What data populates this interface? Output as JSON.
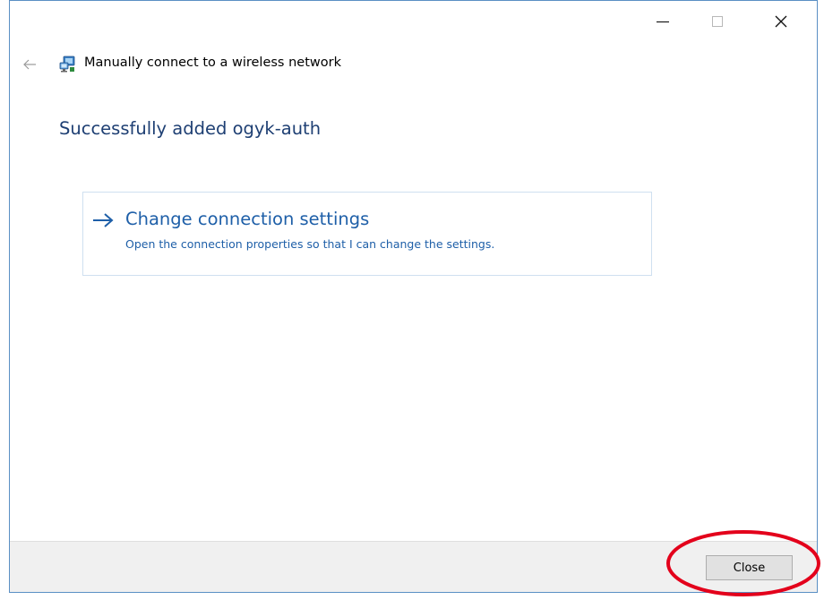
{
  "window": {
    "controls": {
      "minimize": "minimize-icon",
      "maximize": "maximize-icon",
      "close": "close-icon"
    }
  },
  "header": {
    "back_icon": "back-arrow-icon",
    "app_icon": "wireless-network-icon",
    "title": "Manually connect to a wireless network"
  },
  "main": {
    "heading": "Successfully added ogyk-auth",
    "option": {
      "icon": "right-arrow-icon",
      "title": "Change connection settings",
      "description": "Open the connection properties so that I can change the settings."
    }
  },
  "footer": {
    "close_label": "Close"
  },
  "colors": {
    "heading": "#1e3f73",
    "link": "#1e5fa8",
    "highlight": "#e3001b",
    "window_border": "#5a8fc4"
  }
}
